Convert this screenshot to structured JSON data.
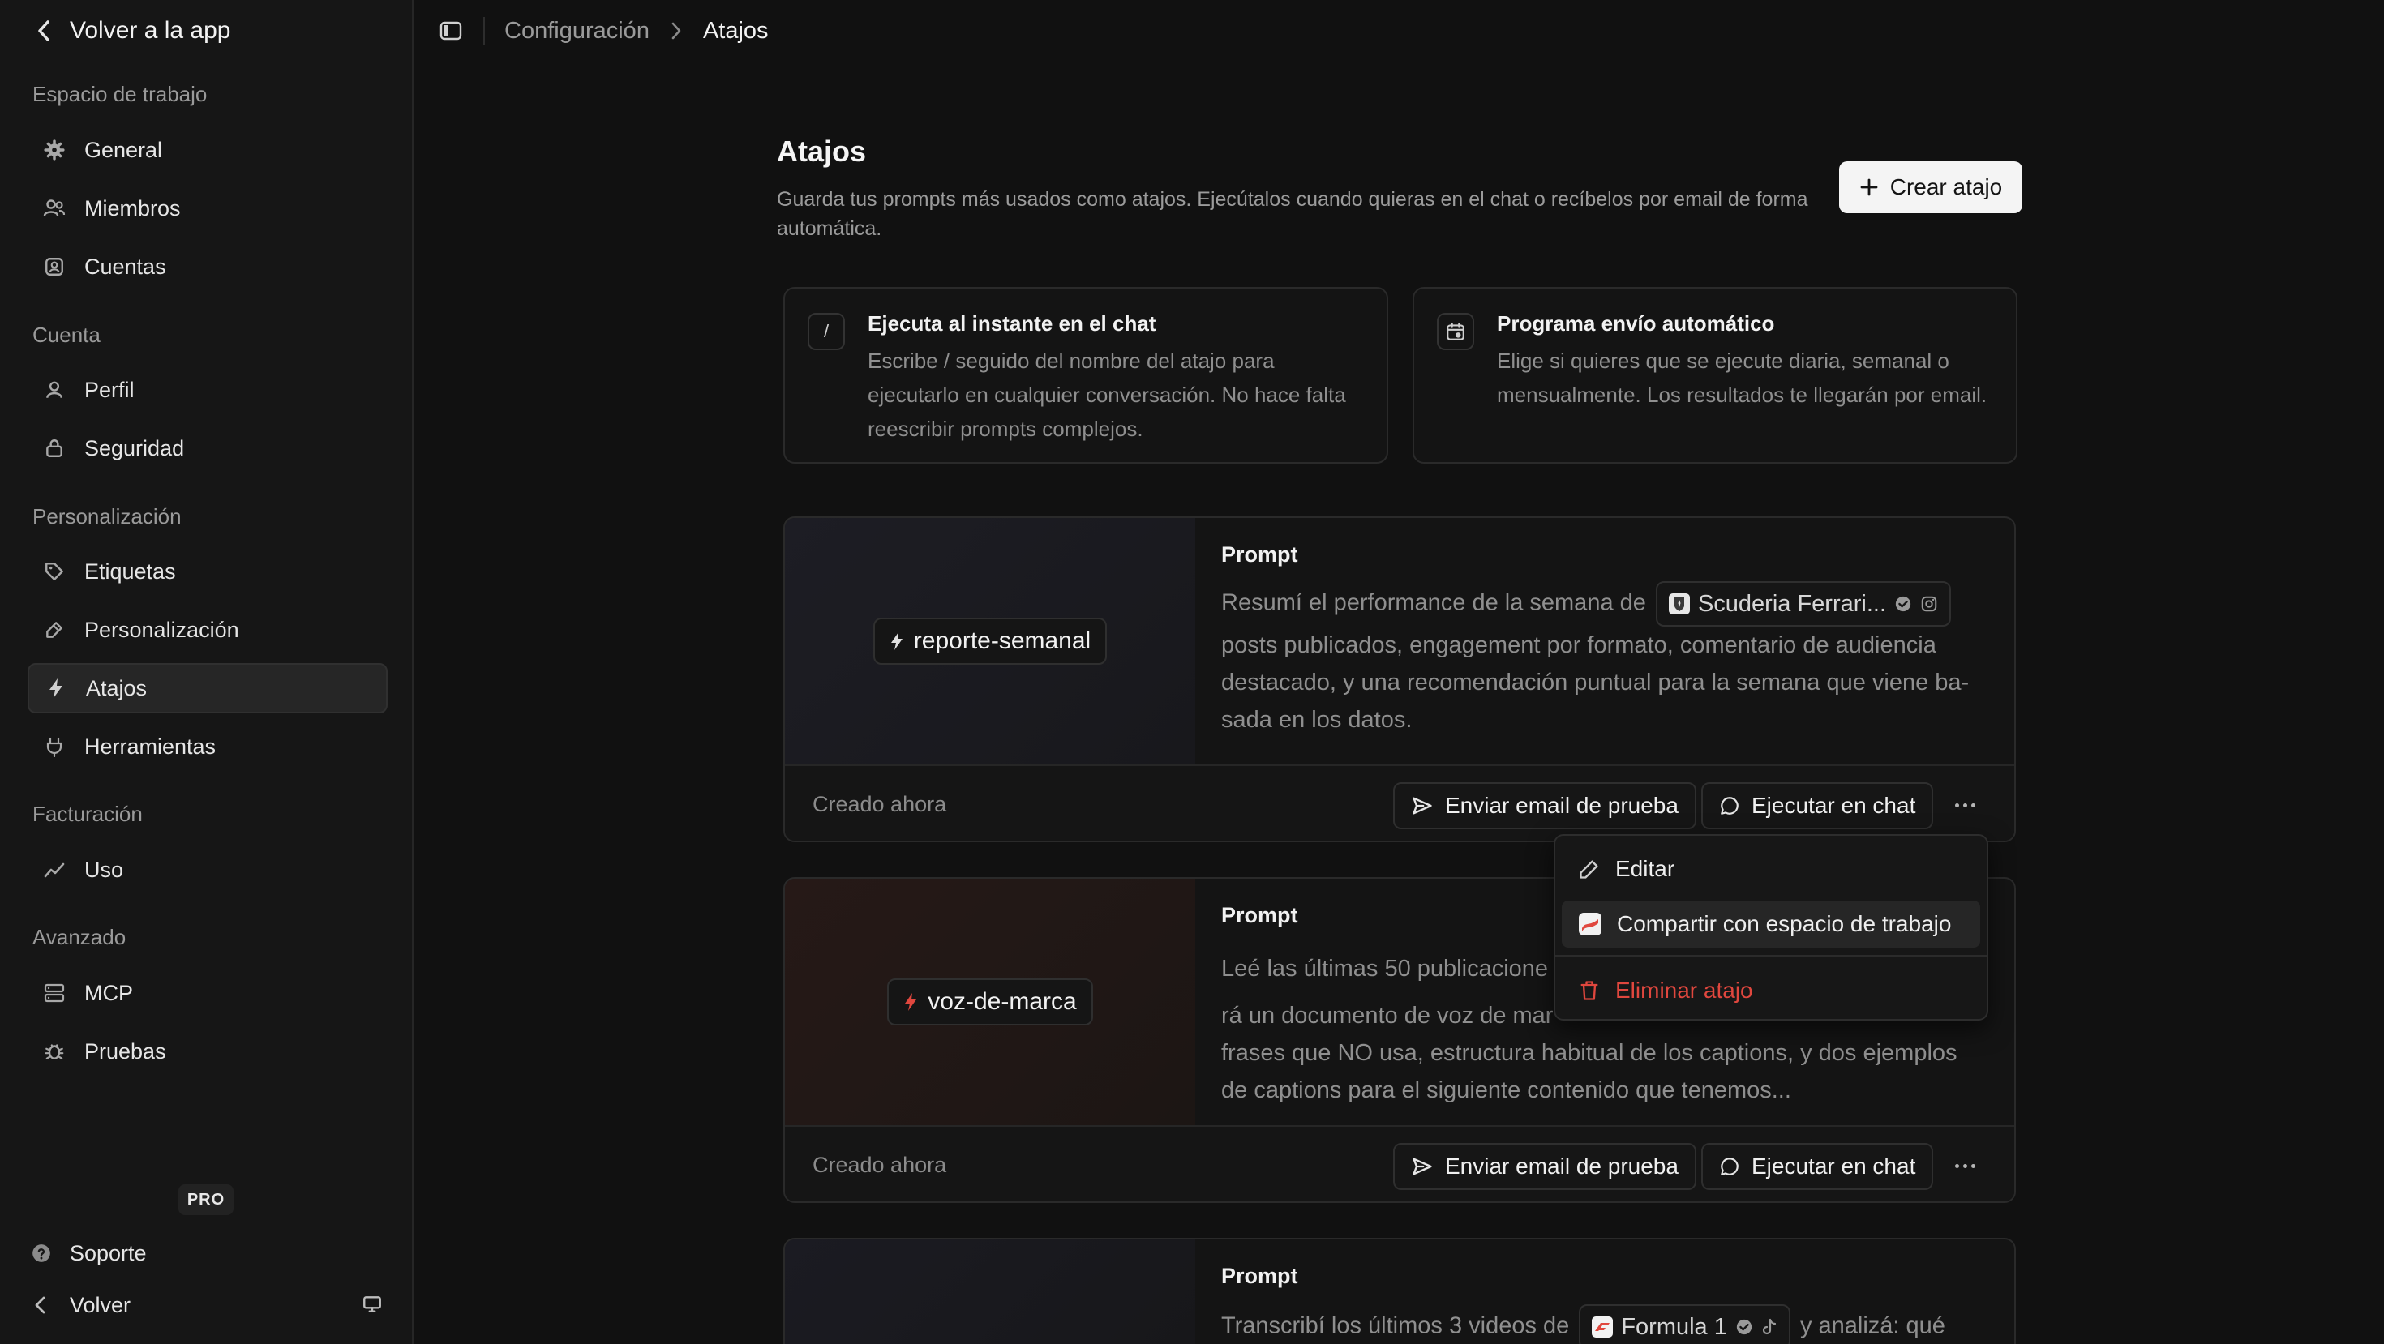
{
  "sidebar": {
    "back_label": "Volver a la app",
    "sections": {
      "workspace": "Espacio de trabajo",
      "account": "Cuenta",
      "personalization": "Personalización",
      "billing": "Facturación",
      "advanced": "Avanzado"
    },
    "items": {
      "general": "General",
      "members": "Miembros",
      "accounts": "Cuentas",
      "profile": "Perfil",
      "security": "Seguridad",
      "tags": "Etiquetas",
      "personalization": "Personalización",
      "shortcuts": "Atajos",
      "tools": "Herramientas",
      "usage": "Uso",
      "mcp": "MCP",
      "tests": "Pruebas"
    },
    "plan_badge": "PRO",
    "support_label": "Soporte",
    "back_bottom_label": "Volver"
  },
  "breadcrumb": {
    "parent": "Configuración",
    "current": "Atajos"
  },
  "header": {
    "title": "Atajos",
    "description": "Guarda tus prompts más usados como atajos. Ejecútalos cuando quieras en el chat o recíbelos por email de forma automática.",
    "create_label": "Crear atajo"
  },
  "info_cards": [
    {
      "icon_text": "/",
      "title": "Ejecuta al instante en el chat",
      "text": "Escribe / seguido del nombre del atajo para ejecutarlo en cualquier conversación. No hace falta reescribir prompts complejos."
    },
    {
      "title": "Programa envío automático",
      "text": "Elige si quieres que se ejecute diaria, semanal o mensualmente. Los resultados te llegarán por email."
    }
  ],
  "shortcuts": [
    {
      "name": "reporte-semanal",
      "prompt_label": "Prompt",
      "text_before": "Resumí el performance de la semana de",
      "mention": "Scuderia Ferrari...",
      "text_after": "posts publicados, engagement por formato, comentario de audiencia destacado, y una recomendación puntual para la semana que viene ba-sada en los datos.",
      "created": "Creado ahora",
      "send_test_label": "Enviar email de prueba",
      "run_chat_label": "Ejecutar en chat"
    },
    {
      "name": "voz-de-marca",
      "prompt_label": "Prompt",
      "line1": "Leé las últimas 50 publicacione",
      "line2": "rá un documento de voz de mar",
      "line3": "frases que NO usa, estructura habitual de los captions, y dos ejemplos",
      "line4": "de captions para el siguiente contenido que tenemos...",
      "created": "Creado ahora",
      "send_test_label": "Enviar email de prueba",
      "run_chat_label": "Ejecutar en chat"
    },
    {
      "prompt_label": "Prompt",
      "text_before": "Transcribí los últimos 3 videos de",
      "mention": "Formula 1",
      "text_after": "y analizá: qué"
    }
  ],
  "menu": {
    "edit": "Editar",
    "share": "Compartir con espacio de trabajo",
    "delete": "Eliminar atajo"
  },
  "colors": {
    "background": "#111111",
    "sidebar": "#161616",
    "accent_red": "#e0473e",
    "primary_button": "#f4f4f4"
  }
}
